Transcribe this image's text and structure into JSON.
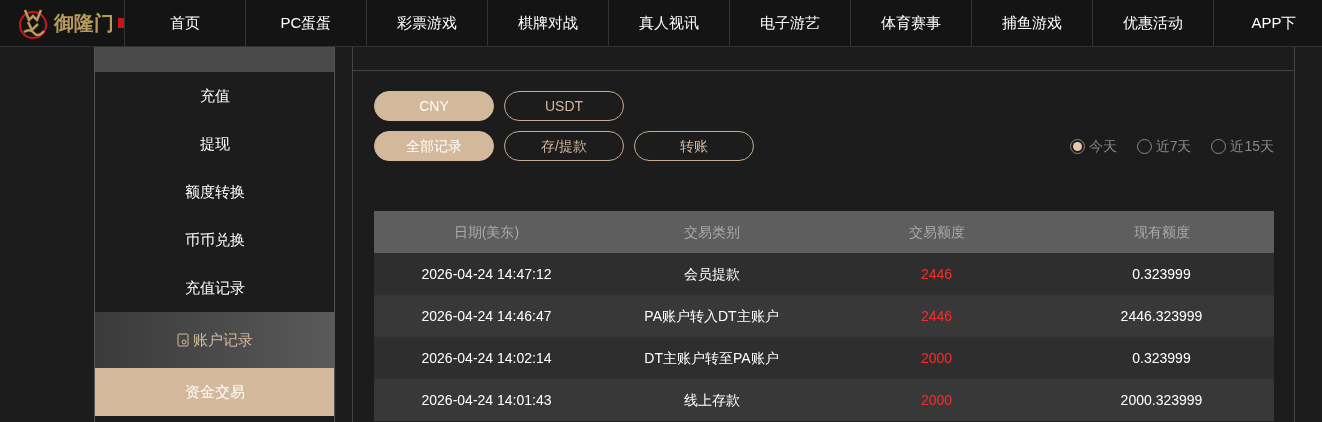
{
  "logo": {
    "text": "御隆门"
  },
  "nav": [
    {
      "label": "首页"
    },
    {
      "label": "PC蛋蛋"
    },
    {
      "label": "彩票游戏"
    },
    {
      "label": "棋牌对战"
    },
    {
      "label": "真人视讯"
    },
    {
      "label": "电子游艺"
    },
    {
      "label": "体育赛事"
    },
    {
      "label": "捕鱼游戏"
    },
    {
      "label": "优惠活动"
    },
    {
      "label": "APP下"
    }
  ],
  "sidebar": {
    "items": [
      {
        "label": "充值",
        "kind": "item",
        "selected": false
      },
      {
        "label": "提现",
        "kind": "item",
        "selected": false
      },
      {
        "label": "额度转换",
        "kind": "item",
        "selected": false
      },
      {
        "label": "币币兑换",
        "kind": "item",
        "selected": false
      },
      {
        "label": "充值记录",
        "kind": "item",
        "selected": false
      },
      {
        "label": "账户记录",
        "kind": "header",
        "selected": false
      },
      {
        "label": "资金交易",
        "kind": "item",
        "selected": true
      }
    ]
  },
  "currency_tabs": [
    {
      "label": "CNY",
      "selected": true
    },
    {
      "label": "USDT",
      "selected": false
    }
  ],
  "type_tabs": [
    {
      "label": "全部记录",
      "selected": true
    },
    {
      "label": "存/提款",
      "selected": false
    },
    {
      "label": "转账",
      "selected": false
    }
  ],
  "ranges": [
    {
      "label": "今天",
      "selected": true
    },
    {
      "label": "近7天",
      "selected": false
    },
    {
      "label": "近15天",
      "selected": false
    }
  ],
  "table": {
    "columns": [
      "日期(美东)",
      "交易类别",
      "交易额度",
      "现有额度"
    ],
    "rows": [
      [
        "2026-04-24 14:47:12",
        "会员提款",
        "2446",
        "0.323999"
      ],
      [
        "2026-04-24 14:46:47",
        "PA账户转入DT主账户",
        "2446",
        "2446.323999"
      ],
      [
        "2026-04-24 14:02:14",
        "DT主账户转至PA账户",
        "2000",
        "0.323999"
      ],
      [
        "2026-04-24 14:01:43",
        "线上存款",
        "2000",
        "2000.323999"
      ]
    ]
  }
}
